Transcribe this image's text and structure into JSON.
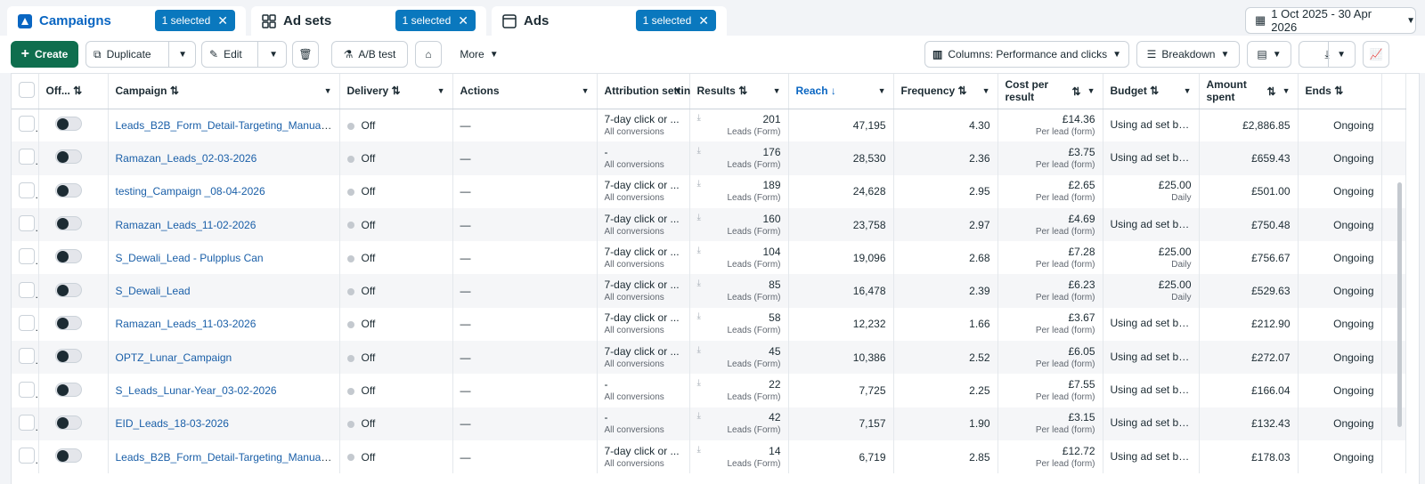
{
  "tabs": [
    {
      "label": "Campaigns",
      "badge": "1 selected",
      "icon": "campaign-icon"
    },
    {
      "label": "Ad sets",
      "badge": "1 selected",
      "icon": "adsets-grid-icon"
    },
    {
      "label": "Ads",
      "badge": "1 selected",
      "icon": "ad-window-icon"
    }
  ],
  "date_range": "1 Oct 2025 - 30 Apr 2026",
  "toolbar": {
    "create": "Create",
    "duplicate": "Duplicate",
    "edit": "Edit",
    "ab_test": "A/B test",
    "more": "More",
    "columns": "Columns: Performance and clicks",
    "breakdown": "Breakdown"
  },
  "columns": {
    "onoff": "Off...",
    "campaign": "Campaign",
    "delivery": "Delivery",
    "actions": "Actions",
    "attribution": "Attribution setting",
    "results": "Results",
    "reach": "Reach",
    "frequency": "Frequency",
    "cpr": "Cost per result",
    "budget": "Budget",
    "spent": "Amount spent",
    "ends": "Ends"
  },
  "rows": [
    {
      "name": "Leads_B2B_Form_Detail-Targeting_Manual-...",
      "delivery": "Off",
      "actions": "—",
      "attr": "7-day click or ...",
      "attr_sub": "All conversions",
      "results": "201",
      "results_sub": "Leads (Form)",
      "reach": "47,195",
      "freq": "4.30",
      "cpr": "£14.36",
      "cpr_sub": "Per lead (form)",
      "budget": "Using ad set bu...",
      "budget_sub": "",
      "spent": "£2,886.85",
      "ends": "Ongoing"
    },
    {
      "name": "Ramazan_Leads_02-03-2026",
      "delivery": "Off",
      "actions": "—",
      "attr": "-",
      "attr_sub": "All conversions",
      "results": "176",
      "results_sub": "Leads (Form)",
      "reach": "28,530",
      "freq": "2.36",
      "cpr": "£3.75",
      "cpr_sub": "Per lead (form)",
      "budget": "Using ad set bu...",
      "budget_sub": "",
      "spent": "£659.43",
      "ends": "Ongoing"
    },
    {
      "name": "testing_Campaign _08-04-2026",
      "delivery": "Off",
      "actions": "—",
      "attr": "7-day click or ...",
      "attr_sub": "All conversions",
      "results": "189",
      "results_sub": "Leads (Form)",
      "reach": "24,628",
      "freq": "2.95",
      "cpr": "£2.65",
      "cpr_sub": "Per lead (form)",
      "budget": "£25.00",
      "budget_sub": "Daily",
      "spent": "£501.00",
      "ends": "Ongoing"
    },
    {
      "name": "Ramazan_Leads_11-02-2026",
      "delivery": "Off",
      "actions": "—",
      "attr": "7-day click or ...",
      "attr_sub": "All conversions",
      "results": "160",
      "results_sub": "Leads (Form)",
      "reach": "23,758",
      "freq": "2.97",
      "cpr": "£4.69",
      "cpr_sub": "Per lead (form)",
      "budget": "Using ad set bu...",
      "budget_sub": "",
      "spent": "£750.48",
      "ends": "Ongoing"
    },
    {
      "name": "S_Dewali_Lead - Pulpplus Can",
      "delivery": "Off",
      "actions": "—",
      "attr": "7-day click or ...",
      "attr_sub": "All conversions",
      "results": "104",
      "results_sub": "Leads (Form)",
      "reach": "19,096",
      "freq": "2.68",
      "cpr": "£7.28",
      "cpr_sub": "Per lead (form)",
      "budget": "£25.00",
      "budget_sub": "Daily",
      "spent": "£756.67",
      "ends": "Ongoing"
    },
    {
      "name": "S_Dewali_Lead",
      "delivery": "Off",
      "actions": "—",
      "attr": "7-day click or ...",
      "attr_sub": "All conversions",
      "results": "85",
      "results_sub": "Leads (Form)",
      "reach": "16,478",
      "freq": "2.39",
      "cpr": "£6.23",
      "cpr_sub": "Per lead (form)",
      "budget": "£25.00",
      "budget_sub": "Daily",
      "spent": "£529.63",
      "ends": "Ongoing"
    },
    {
      "name": "Ramazan_Leads_11-03-2026",
      "delivery": "Off",
      "actions": "—",
      "attr": "7-day click or ...",
      "attr_sub": "All conversions",
      "results": "58",
      "results_sub": "Leads (Form)",
      "reach": "12,232",
      "freq": "1.66",
      "cpr": "£3.67",
      "cpr_sub": "Per lead (form)",
      "budget": "Using ad set bu...",
      "budget_sub": "",
      "spent": "£212.90",
      "ends": "Ongoing"
    },
    {
      "name": "OPTZ_Lunar_Campaign",
      "delivery": "Off",
      "actions": "—",
      "attr": "7-day click or ...",
      "attr_sub": "All conversions",
      "results": "45",
      "results_sub": "Leads (Form)",
      "reach": "10,386",
      "freq": "2.52",
      "cpr": "£6.05",
      "cpr_sub": "Per lead (form)",
      "budget": "Using ad set bu...",
      "budget_sub": "",
      "spent": "£272.07",
      "ends": "Ongoing"
    },
    {
      "name": "S_Leads_Lunar-Year_03-02-2026",
      "delivery": "Off",
      "actions": "—",
      "attr": "-",
      "attr_sub": "All conversions",
      "results": "22",
      "results_sub": "Leads (Form)",
      "reach": "7,725",
      "freq": "2.25",
      "cpr": "£7.55",
      "cpr_sub": "Per lead (form)",
      "budget": "Using ad set bu...",
      "budget_sub": "",
      "spent": "£166.04",
      "ends": "Ongoing"
    },
    {
      "name": "EID_Leads_18-03-2026",
      "delivery": "Off",
      "actions": "—",
      "attr": "-",
      "attr_sub": "All conversions",
      "results": "42",
      "results_sub": "Leads (Form)",
      "reach": "7,157",
      "freq": "1.90",
      "cpr": "£3.15",
      "cpr_sub": "Per lead (form)",
      "budget": "Using ad set bu...",
      "budget_sub": "",
      "spent": "£132.43",
      "ends": "Ongoing"
    },
    {
      "name": "Leads_B2B_Form_Detail-Targeting_Manual-...",
      "delivery": "Off",
      "actions": "—",
      "attr": "7-day click or ...",
      "attr_sub": "All conversions",
      "results": "14",
      "results_sub": "Leads (Form)",
      "reach": "6,719",
      "freq": "2.85",
      "cpr": "£12.72",
      "cpr_sub": "Per lead (form)",
      "budget": "Using ad set bu...",
      "budget_sub": "",
      "spent": "£178.03",
      "ends": "Ongoing"
    }
  ],
  "colors": {
    "accent": "#0a66c2",
    "create_green": "#0f6e4e",
    "badge_blue": "#0a78be"
  }
}
